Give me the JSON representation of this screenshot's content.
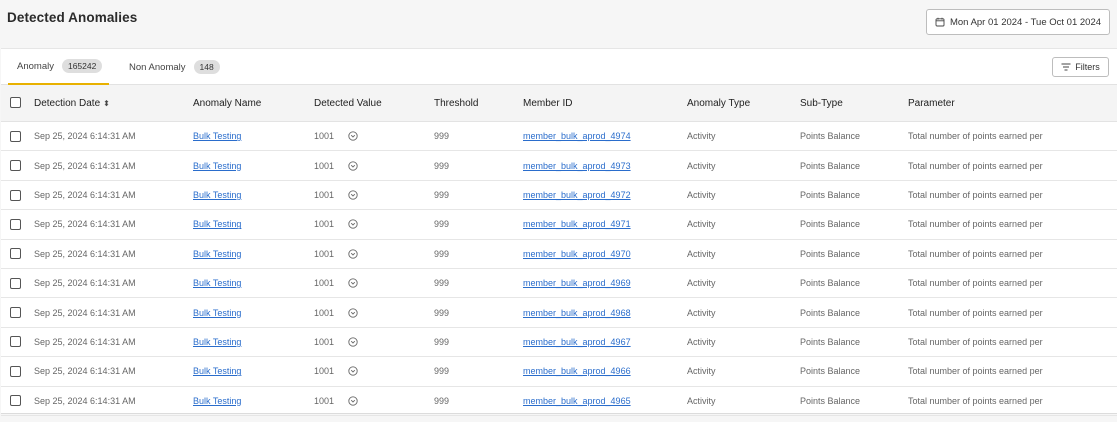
{
  "header": {
    "title": "Detected Anomalies",
    "date_range": "Mon Apr 01 2024 - Tue Oct 01 2024",
    "date_icon": "calendar-icon"
  },
  "tabs": [
    {
      "label": "Anomaly",
      "count": "165242",
      "active": true
    },
    {
      "label": "Non Anomaly",
      "count": "148",
      "active": false
    }
  ],
  "toolbar": {
    "filters_label": "Filters",
    "filters_icon": "filter-lines-icon"
  },
  "table": {
    "columns": [
      "Detection Date",
      "Anomaly Name",
      "Detected Value",
      "Threshold",
      "Member ID",
      "Anomaly Type",
      "Sub-Type",
      "Parameter"
    ],
    "sort_icon": "sort-updown-icon",
    "rows": [
      {
        "date": "Sep 25, 2024 6:14:31 AM",
        "name": "Bulk Testing",
        "value": "1001",
        "threshold": "999",
        "member": "member_bulk_aprod_4974",
        "type": "Activity",
        "subtype": "Points Balance",
        "parameter": "Total number of points earned per"
      },
      {
        "date": "Sep 25, 2024 6:14:31 AM",
        "name": "Bulk Testing",
        "value": "1001",
        "threshold": "999",
        "member": "member_bulk_aprod_4973",
        "type": "Activity",
        "subtype": "Points Balance",
        "parameter": "Total number of points earned per"
      },
      {
        "date": "Sep 25, 2024 6:14:31 AM",
        "name": "Bulk Testing",
        "value": "1001",
        "threshold": "999",
        "member": "member_bulk_aprod_4972",
        "type": "Activity",
        "subtype": "Points Balance",
        "parameter": "Total number of points earned per"
      },
      {
        "date": "Sep 25, 2024 6:14:31 AM",
        "name": "Bulk Testing",
        "value": "1001",
        "threshold": "999",
        "member": "member_bulk_aprod_4971",
        "type": "Activity",
        "subtype": "Points Balance",
        "parameter": "Total number of points earned per"
      },
      {
        "date": "Sep 25, 2024 6:14:31 AM",
        "name": "Bulk Testing",
        "value": "1001",
        "threshold": "999",
        "member": "member_bulk_aprod_4970",
        "type": "Activity",
        "subtype": "Points Balance",
        "parameter": "Total number of points earned per"
      },
      {
        "date": "Sep 25, 2024 6:14:31 AM",
        "name": "Bulk Testing",
        "value": "1001",
        "threshold": "999",
        "member": "member_bulk_aprod_4969",
        "type": "Activity",
        "subtype": "Points Balance",
        "parameter": "Total number of points earned per"
      },
      {
        "date": "Sep 25, 2024 6:14:31 AM",
        "name": "Bulk Testing",
        "value": "1001",
        "threshold": "999",
        "member": "member_bulk_aprod_4968",
        "type": "Activity",
        "subtype": "Points Balance",
        "parameter": "Total number of points earned per"
      },
      {
        "date": "Sep 25, 2024 6:14:31 AM",
        "name": "Bulk Testing",
        "value": "1001",
        "threshold": "999",
        "member": "member_bulk_aprod_4967",
        "type": "Activity",
        "subtype": "Points Balance",
        "parameter": "Total number of points earned per"
      },
      {
        "date": "Sep 25, 2024 6:14:31 AM",
        "name": "Bulk Testing",
        "value": "1001",
        "threshold": "999",
        "member": "member_bulk_aprod_4966",
        "type": "Activity",
        "subtype": "Points Balance",
        "parameter": "Total number of points earned per"
      },
      {
        "date": "Sep 25, 2024 6:14:31 AM",
        "name": "Bulk Testing",
        "value": "1001",
        "threshold": "999",
        "member": "member_bulk_aprod_4965",
        "type": "Activity",
        "subtype": "Points Balance",
        "parameter": "Total number of points earned per"
      }
    ]
  },
  "colors": {
    "accent_tab": "#e8b100",
    "link": "#2a6dcc",
    "header_bg": "#f4f4f4"
  }
}
